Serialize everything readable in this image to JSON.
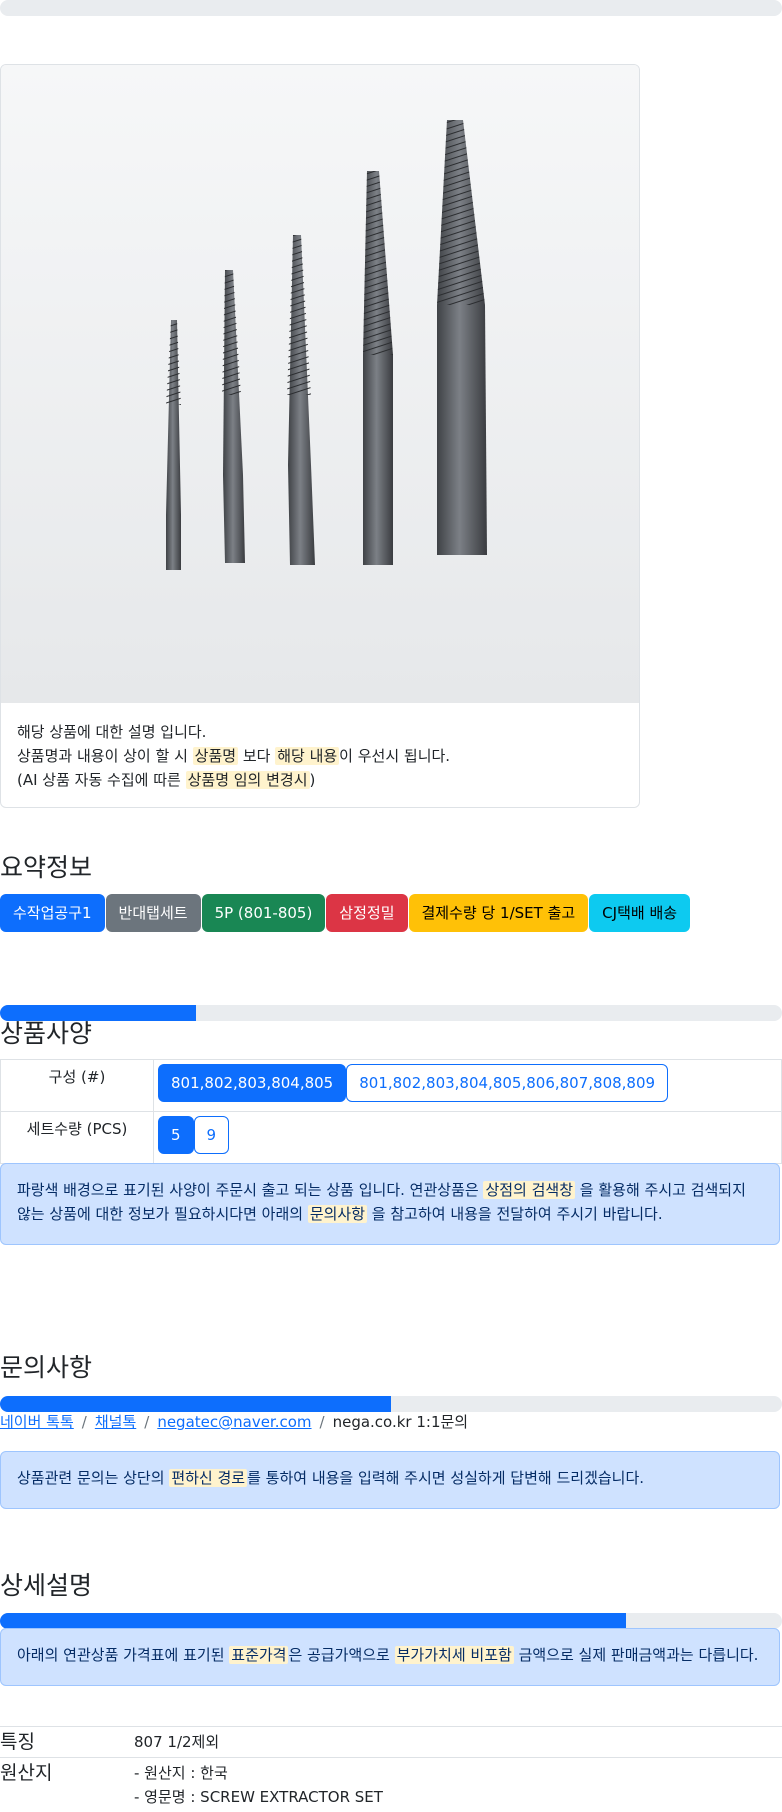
{
  "image_card": {
    "image_alt": "Screw extractor set 5 pieces",
    "desc_line1": "해당 상품에 대한 설명 입니다.",
    "desc_line2_a": "상품명과 내용이 상이 할 시 ",
    "desc_line2_hl1": "상품명",
    "desc_line2_b": " 보다 ",
    "desc_line2_hl2": "해당 내용",
    "desc_line2_c": "이 우선시 됩니다.",
    "desc_line3_a": "(AI 상품 자동 수집에 따른 ",
    "desc_line3_hl": "상품명 임의 변경시",
    "desc_line3_b": ")"
  },
  "summary": {
    "title": "요약정보",
    "badges": [
      "수작업공구1",
      "반대탭세트",
      "5P (801-805)",
      "삼정정밀",
      "결제수량 당 1/SET 출고",
      "CJ택배 배송"
    ]
  },
  "specs": {
    "title": "상품사양",
    "progress_fraction": 0.25,
    "rows": [
      {
        "label": "구성 (#)",
        "options": [
          "801,802,803,804,805",
          "801,802,803,804,805,806,807,808,809"
        ],
        "selected": 0
      },
      {
        "label": "세트수량 (PCS)",
        "options": [
          "5",
          "9"
        ],
        "selected": 0
      }
    ],
    "notice_a": "파랑색 배경으로 표기된 사양이 주문시 출고 되는 상품 입니다. 연관상품은 ",
    "notice_hl1": "상점의 검색창",
    "notice_b": " 을 활용해 주시고 검색되지 않는 상품에 대한 정보가 필요하시다면 아래의 ",
    "notice_hl2": "문의사항",
    "notice_c": " 을 참고하여 내용을 전달하여 주시기 바랍니다."
  },
  "inquiry": {
    "title": "문의사항",
    "progress_fraction": 0.5,
    "links": [
      "네이버 톡톡",
      "채널톡",
      "negatec@naver.com"
    ],
    "plain": "nega.co.kr 1:1문의",
    "separator": "/",
    "notice_a": "상품관련 문의는 상단의 ",
    "notice_hl": "편하신 경로",
    "notice_b": "를 통하여 내용을 입력해 주시면 성실하게 답변해 드리겠습니다."
  },
  "details": {
    "title": "상세설명",
    "progress_fraction": 0.8,
    "notice_a": "아래의 연관상품 가격표에 표기된 ",
    "notice_hl1": "표준가격",
    "notice_b": "은 공급가액으로 ",
    "notice_hl2": "부가가치세 비포함",
    "notice_c": " 금액으로 실제 판매금액과는 다릅니다.",
    "rows": [
      {
        "key": "특징",
        "values": [
          "807 1/2제외"
        ]
      },
      {
        "key": "원산지",
        "values": [
          "- 원산지 : 한국",
          "- 영문명 : SCREW EXTRACTOR SET"
        ]
      }
    ]
  },
  "colors": {
    "primary": "#0d6efd",
    "secondary": "#6c757d",
    "success": "#198754",
    "danger": "#dc3545",
    "warning": "#ffc107",
    "info": "#0dcaf0",
    "highlight": "#fff3cd",
    "alert_bg": "#cfe2ff"
  }
}
